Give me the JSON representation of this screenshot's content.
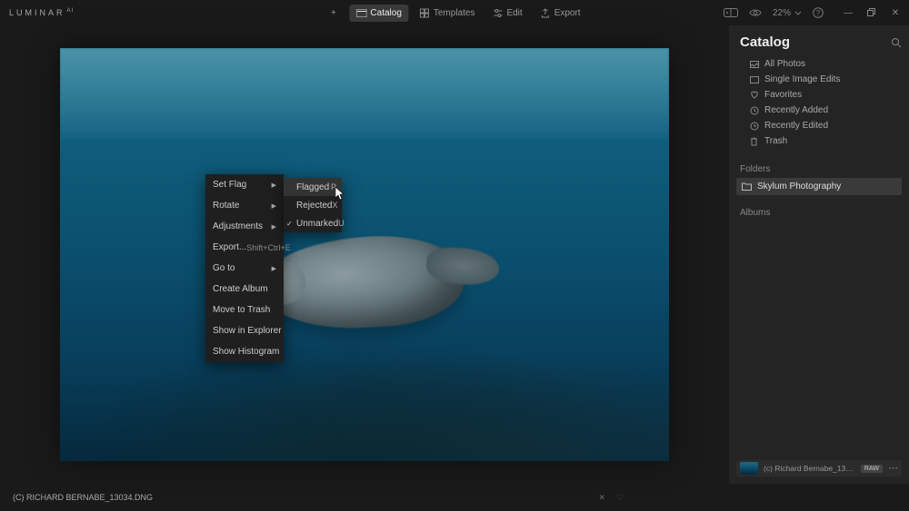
{
  "app": {
    "name": "LUMINAR",
    "suffix": "AI"
  },
  "topbar": {
    "add": "+",
    "catalog": "Catalog",
    "templates": "Templates",
    "edit": "Edit",
    "export": "Export",
    "zoom": "22%"
  },
  "context_menu": {
    "set_flag": "Set Flag",
    "rotate": "Rotate",
    "adjustments": "Adjustments",
    "export": "Export...",
    "export_shortcut": "Shift+Ctrl+E",
    "go_to": "Go to",
    "create_album": "Create Album",
    "move_to_trash": "Move to Trash",
    "show_in_explorer": "Show in Explorer",
    "show_histogram": "Show Histogram"
  },
  "submenu": {
    "flagged": "Flagged",
    "flagged_key": "P",
    "rejected": "Rejected",
    "rejected_key": "X",
    "unmarked": "Unmarked",
    "unmarked_key": "U"
  },
  "right": {
    "title": "Catalog",
    "shortcuts": {
      "all": "All Photos",
      "single": "Single Image Edits",
      "fav": "Favorites",
      "recent_add": "Recently Added",
      "recent_edit": "Recently Edited",
      "trash": "Trash"
    },
    "folders_label": "Folders",
    "folder_name": "Skylum Photography",
    "albums_label": "Albums",
    "thumb_name": "(c) Richard Bernabe_13034.dng",
    "thumb_badge": "RAW"
  },
  "bottom": {
    "filename": "(C) RICHARD BERNABE_13034.DNG"
  }
}
